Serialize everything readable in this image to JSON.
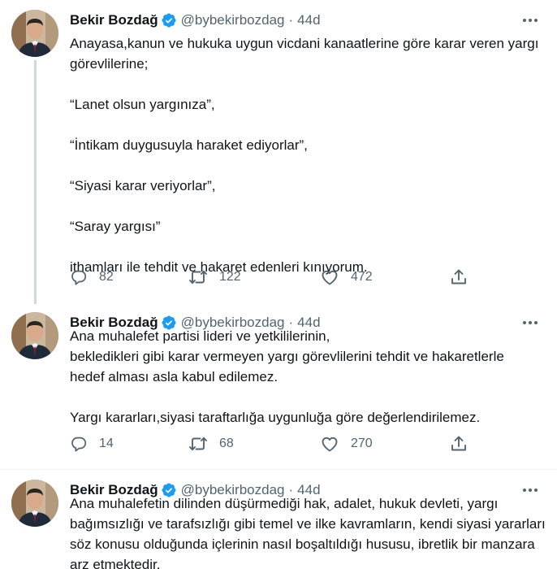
{
  "account": {
    "name": "Bekir Bozdağ",
    "handle": "@bybekirbozdag",
    "separator": "·"
  },
  "tweets": [
    {
      "time": "44d",
      "lines": [
        "Anayasa,kanun ve hukuka uygun vicdani kanaatlerine göre karar veren yargı",
        "görevlilerine;",
        "",
        "“Lanet olsun yargınıza”,",
        "",
        "“İntikam duygusuyla haraket ediyorlar”,",
        "",
        "“Siyasi karar veriyorlar”,",
        "",
        "“Saray yargısı”",
        "",
        "ithamları ile tehdit ve hakaret edenleri kınıyorum."
      ],
      "replies": "82",
      "retweets": "122",
      "likes": "472"
    },
    {
      "time": "44d",
      "lines": [
        "Ana muhalefet partisi lideri ve yetkililerinin,",
        "bekledikleri gibi karar vermeyen yargı görevlilerini tehdit ve hakaretlerle",
        "hedef alması asla kabul  edilemez.",
        "",
        "Yargı kararları,siyasi taraftarlığa uygunluğa göre değerlendirilemez."
      ],
      "replies": "14",
      "retweets": "68",
      "likes": "270"
    },
    {
      "time": "44d",
      "lines": [
        "Ana muhalefetin dilinden düşürmediği hak, adalet, hukuk devleti, yargı",
        "bağımsızlığı ve tarafsızlığı gibi temel ve ilke kavramların, kendi siyasi yararları",
        "söz konusu olduğunda içlerinin nasıl boşaltıldığı hususu, ibretlik bir manzara",
        "arz etmektedir."
      ]
    }
  ],
  "colors": {
    "text": "#0f1419",
    "secondary": "#536471",
    "verified": "#1d9bf0",
    "thread_line": "#cfd9de",
    "divider": "#eff3f4"
  },
  "icons": [
    "verified-badge-icon",
    "more-icon",
    "reply-icon",
    "retweet-icon",
    "like-icon",
    "share-icon"
  ]
}
